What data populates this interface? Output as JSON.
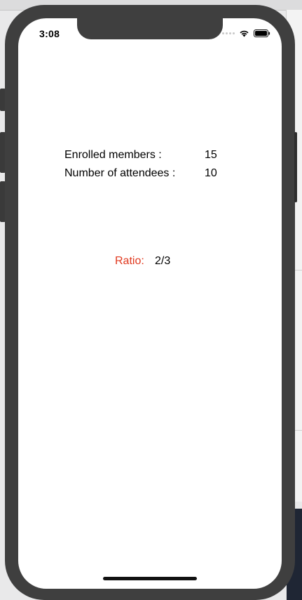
{
  "status_bar": {
    "time": "3:08"
  },
  "stats": {
    "enrolled_label": "Enrolled members :",
    "enrolled_value": "15",
    "attendees_label": "Number of attendees :",
    "attendees_value": "10"
  },
  "ratio": {
    "label": "Ratio:",
    "value": "2/3",
    "label_color": "#e0391f"
  },
  "icons": {
    "wifi": "wifi-icon",
    "battery": "battery-icon",
    "signal": "cellular-signal-icon"
  }
}
